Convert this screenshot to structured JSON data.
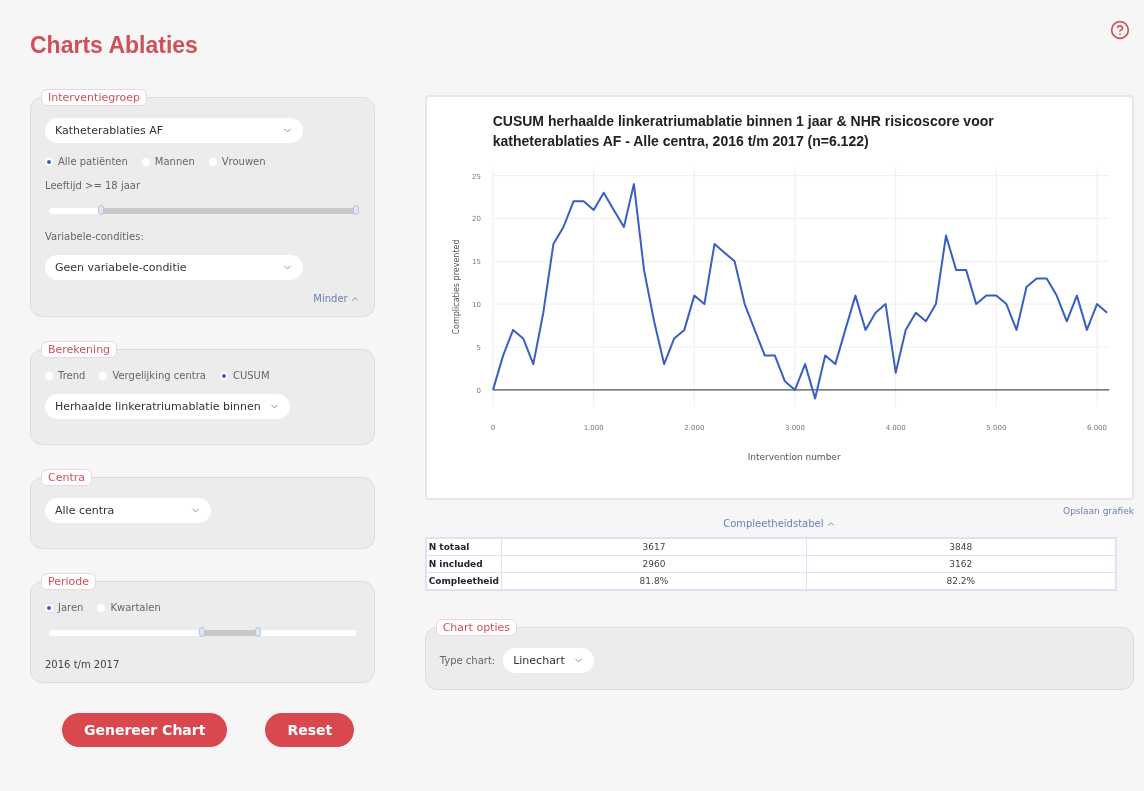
{
  "title": "Charts Ablaties",
  "interventiegroep": {
    "legend": "Interventiegroep",
    "select": "Katheterablaties AF",
    "radios": [
      {
        "label": "Alle patiënten",
        "selected": true
      },
      {
        "label": "Mannen",
        "selected": false
      },
      {
        "label": "Vrouwen",
        "selected": false
      }
    ],
    "age_label": "Leeftijd >= 18 jaar",
    "age_slider": {
      "start": {
        "level": 0.17
      },
      "end": {
        "level": 1.0
      }
    },
    "conditions_label": "Variabele-condities:",
    "conditions_select": "Geen variabele-conditie",
    "less_link": "Minder"
  },
  "berekening": {
    "legend": "Berekening",
    "radios": [
      {
        "label": "Trend",
        "selected": false
      },
      {
        "label": "Vergelijking centra",
        "selected": false
      },
      {
        "label": "CUSUM",
        "selected": true
      }
    ],
    "select": "Herhaalde linkeratriumablatie binnen"
  },
  "centra": {
    "legend": "Centra",
    "select": "Alle centra"
  },
  "periode": {
    "legend": "Periode",
    "radios": [
      {
        "label": "Jaren",
        "selected": true
      },
      {
        "label": "Kwartalen",
        "selected": false
      }
    ],
    "slider": {
      "start": {
        "level": 0.5
      },
      "end": {
        "level": 0.68
      }
    },
    "range": "2016 t/m 2017"
  },
  "buttons": [
    "Genereer Chart",
    "Reset"
  ],
  "chart": {
    "title": "CUSUM herhaalde linkeratriumablatie binnen 1 jaar & NHR risicoscore voor katheterablaties AF - Alle centra, 2016 t/m 2017 (n=6.122)",
    "chart_data": {
      "type": "line",
      "xlabel": "Intervention number",
      "ylabel": "Complicaties prevented",
      "x": [
        0,
        0.1,
        0.2,
        0.3,
        0.4,
        0.5,
        0.6,
        0.7,
        0.8,
        0.9,
        1,
        1.1,
        1.2,
        1.3,
        1.4,
        1.5,
        1.6,
        1.7,
        1.8,
        1.9,
        2,
        2.1,
        2.2,
        2.3,
        2.4,
        2.5,
        2.6,
        2.7,
        2.8,
        2.9,
        3,
        3.1,
        3.2,
        3.3,
        3.4,
        3.5,
        3.6,
        3.7,
        3.8,
        3.9,
        4,
        4.1,
        4.2,
        4.3,
        4.4,
        4.5,
        4.6,
        4.7,
        4.8,
        4.9,
        5,
        5.1,
        5.2,
        5.3,
        5.4,
        5.5,
        5.6,
        5.7,
        5.8,
        5.9,
        6,
        6.1
      ],
      "series": [
        {
          "color": "#3a5fc4",
          "values": [
            0,
            4,
            7,
            6,
            3,
            9,
            17,
            19,
            22,
            22,
            21,
            23,
            21,
            19,
            24,
            14,
            8,
            3,
            6,
            7,
            11,
            10,
            17,
            16,
            15,
            10,
            7,
            4,
            4,
            1,
            0,
            3,
            -1,
            4,
            3,
            7,
            11,
            7,
            9,
            10,
            2,
            7,
            9,
            8,
            10,
            18,
            14,
            14,
            10,
            11,
            11,
            10,
            7,
            12,
            13,
            13,
            11,
            8,
            11,
            7,
            10,
            9
          ]
        }
      ],
      "xlim": [
        0,
        6.122
      ],
      "ylim": [
        -2,
        26
      ],
      "grid": true,
      "xticks": [
        0,
        {
          "value": 1,
          "label": "1.000"
        },
        {
          "value": 2,
          "label": "2.000"
        },
        {
          "value": 3,
          "label": "3.000"
        },
        {
          "value": 4,
          "label": "4.000"
        },
        {
          "value": 5,
          "label": "5.000"
        },
        {
          "value": 6,
          "label": "6.000"
        }
      ],
      "yticks": [
        0,
        5,
        10,
        15,
        20,
        25
      ]
    }
  },
  "save_link": "Opslaan grafiek",
  "completeness_toggle": "Compleetheidstabel",
  "table": {
    "rows": [
      {
        "label": "N totaal",
        "values": [
          "3617",
          "3848"
        ]
      },
      {
        "label": "N included",
        "values": [
          "2960",
          "3162"
        ]
      },
      {
        "label": "Compleetheid",
        "values": [
          "81.8%",
          "82.2%"
        ]
      }
    ]
  },
  "chart_options": {
    "legend": "Chart opties",
    "label": "Type chart:",
    "select": "Linechart"
  }
}
